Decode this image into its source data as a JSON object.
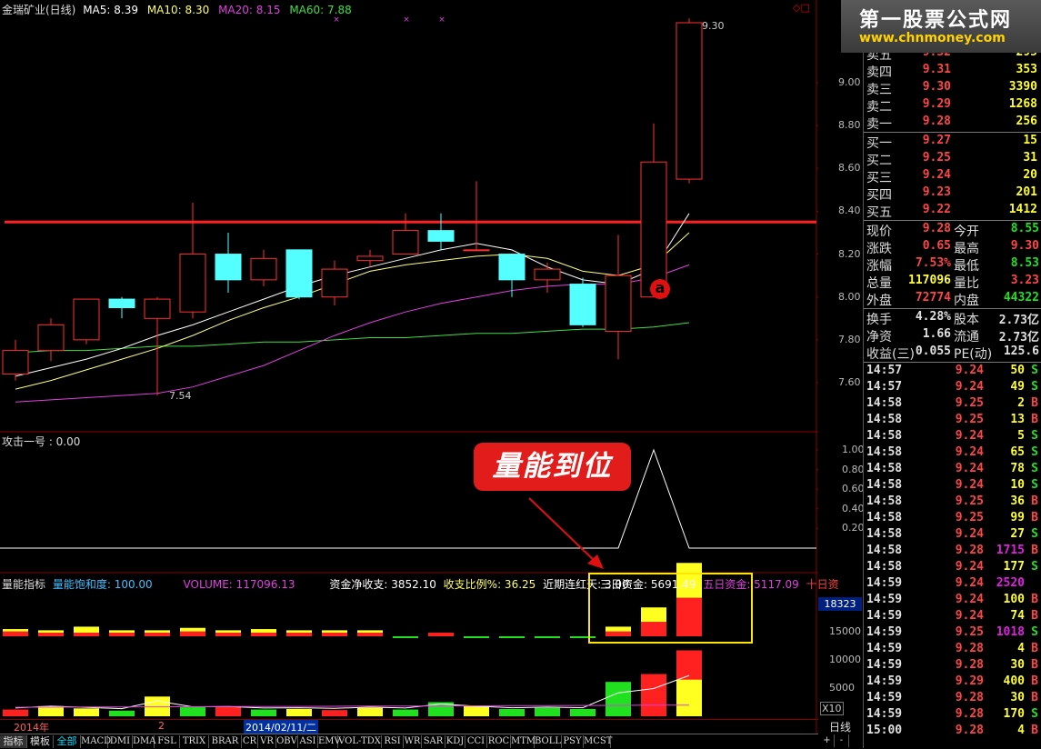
{
  "header": {
    "title": "金瑞矿业(日线)",
    "ma5": "MA5: 8.39",
    "ma10": "MA10: 8.30",
    "ma20": "MA20: 8.15",
    "ma60": "MA60: 7.88",
    "high_label": "9.30",
    "low_label": "7.54",
    "y_ticks": [
      "9.00",
      "8.80",
      "8.60",
      "8.40",
      "8.20",
      "8.00",
      "7.80",
      "7.60"
    ],
    "marker_a": "a"
  },
  "indicator1": {
    "title": "攻击一号 : 0.00",
    "y_ticks": [
      "1.00",
      "0.80",
      "0.60",
      "0.40",
      "0.20"
    ],
    "callout": "量能到位"
  },
  "indicator2": {
    "title": "量能指标",
    "saturation": "量能饱和度: 100.00",
    "volume": "VOLUME: 117096.13",
    "net_funds": "资金净收支: 3852.10",
    "ratio": "收支比例%: 36.25",
    "streak": "近期连红天: 3.00",
    "three_day": "三日资金: 5691.49",
    "five_day": "五日资金: 5117.09",
    "ten_day": "十日资",
    "current_value": "18323",
    "y_ticks": [
      "15000",
      "10000",
      "5000"
    ],
    "x10": "X10"
  },
  "timeline": {
    "year": "2014年",
    "mid": "2",
    "date": "2014/02/11/二",
    "period": "日线"
  },
  "tabs": [
    "指标",
    "模板",
    "全部",
    "MACD",
    "DMI",
    "DMA",
    "FSL",
    "TRIX",
    "BRAR",
    "CR",
    "VR",
    "OBV",
    "ASI",
    "EMV",
    "VOL-TDX",
    "RSI",
    "WR",
    "SAR",
    "KDJ",
    "CCI",
    "ROC",
    "MTM",
    "BOLL",
    "PSY",
    "MCST"
  ],
  "tab_controls": [
    "+",
    "-"
  ],
  "logo": {
    "title": "第一股票公式网",
    "url": "www.chnmoney.com"
  },
  "order_book": {
    "sell": [
      {
        "label": "卖五",
        "price": "9.32",
        "vol": "295"
      },
      {
        "label": "卖四",
        "price": "9.31",
        "vol": "353"
      },
      {
        "label": "卖三",
        "price": "9.30",
        "vol": "3390"
      },
      {
        "label": "卖二",
        "price": "9.29",
        "vol": "1268"
      },
      {
        "label": "卖一",
        "price": "9.28",
        "vol": "256"
      }
    ],
    "buy": [
      {
        "label": "买一",
        "price": "9.27",
        "vol": "15"
      },
      {
        "label": "买二",
        "price": "9.25",
        "vol": "31"
      },
      {
        "label": "买三",
        "price": "9.24",
        "vol": "20"
      },
      {
        "label": "买四",
        "price": "9.23",
        "vol": "201"
      },
      {
        "label": "买五",
        "price": "9.22",
        "vol": "1412"
      }
    ]
  },
  "quote": [
    {
      "l1": "现价",
      "v1": "9.28",
      "c1": "#ff4545",
      "l2": "今开",
      "v2": "8.55",
      "c2": "#20e020"
    },
    {
      "l1": "涨跌",
      "v1": "0.65",
      "c1": "#ff4545",
      "l2": "最高",
      "v2": "9.30",
      "c2": "#ff4545"
    },
    {
      "l1": "涨幅",
      "v1": "7.53%",
      "c1": "#ff4545",
      "l2": "最低",
      "v2": "8.53",
      "c2": "#20e020"
    },
    {
      "l1": "总量",
      "v1": "117096",
      "c1": "#ffff30",
      "l2": "量比",
      "v2": "3.23",
      "c2": "#ff4545"
    },
    {
      "l1": "外盘",
      "v1": "72774",
      "c1": "#ff4545",
      "l2": "内盘",
      "v2": "44322",
      "c2": "#20e020"
    }
  ],
  "quote2": [
    {
      "l1": "换手",
      "v1": "4.28%",
      "c1": "#e0e0e0",
      "l2": "股本",
      "v2": "2.73亿",
      "c2": "#e0e0e0"
    },
    {
      "l1": "净资",
      "v1": "1.66",
      "c1": "#e0e0e0",
      "l2": "流通",
      "v2": "2.73亿",
      "c2": "#e0e0e0"
    },
    {
      "l1": "收益(三)",
      "v1": "0.055",
      "c1": "#e0e0e0",
      "l2": "PE(动)",
      "v2": "125.6",
      "c2": "#e0e0e0"
    }
  ],
  "trades": [
    {
      "t": "14:57",
      "p": "9.24",
      "v": "50",
      "bs": "S"
    },
    {
      "t": "14:57",
      "p": "9.24",
      "v": "49",
      "bs": "S"
    },
    {
      "t": "14:58",
      "p": "9.25",
      "v": "2",
      "bs": "B"
    },
    {
      "t": "14:58",
      "p": "9.25",
      "v": "13",
      "bs": "B"
    },
    {
      "t": "14:58",
      "p": "9.24",
      "v": "5",
      "bs": "S"
    },
    {
      "t": "14:58",
      "p": "9.24",
      "v": "65",
      "bs": "S"
    },
    {
      "t": "14:58",
      "p": "9.24",
      "v": "78",
      "bs": "S"
    },
    {
      "t": "14:58",
      "p": "9.24",
      "v": "10",
      "bs": "S"
    },
    {
      "t": "14:58",
      "p": "9.25",
      "v": "36",
      "bs": "B"
    },
    {
      "t": "14:58",
      "p": "9.25",
      "v": "99",
      "bs": "B"
    },
    {
      "t": "14:58",
      "p": "9.24",
      "v": "27",
      "bs": "S"
    },
    {
      "t": "14:58",
      "p": "9.28",
      "v": "1715",
      "bs": "B",
      "big": true
    },
    {
      "t": "14:58",
      "p": "9.24",
      "v": "177",
      "bs": "S"
    },
    {
      "t": "14:59",
      "p": "9.24",
      "v": "2520",
      "bs": "",
      "big": true
    },
    {
      "t": "14:59",
      "p": "9.24",
      "v": "100",
      "bs": "B"
    },
    {
      "t": "14:59",
      "p": "9.24",
      "v": "74",
      "bs": "B"
    },
    {
      "t": "14:59",
      "p": "9.25",
      "v": "1018",
      "bs": "S",
      "big": true
    },
    {
      "t": "14:59",
      "p": "9.28",
      "v": "4",
      "bs": "B"
    },
    {
      "t": "14:59",
      "p": "9.28",
      "v": "30",
      "bs": "B"
    },
    {
      "t": "14:59",
      "p": "9.29",
      "v": "400",
      "bs": "B"
    },
    {
      "t": "14:59",
      "p": "9.28",
      "v": "30",
      "bs": "B"
    },
    {
      "t": "14:59",
      "p": "9.28",
      "v": "170",
      "bs": "S"
    },
    {
      "t": "15:00",
      "p": "9.28",
      "v": "4",
      "bs": "B"
    }
  ],
  "colors": {
    "up": "#ff3030",
    "down": "#54ffff",
    "ma5": "#ffffff",
    "ma10": "#ffff80",
    "ma20": "#e040e0",
    "ma60": "#40e040",
    "resistance": "#ff2020"
  },
  "chart_data": {
    "type": "candlestick",
    "ylim": [
      7.5,
      9.4
    ],
    "candles": [
      {
        "o": 7.64,
        "c": 7.75,
        "h": 7.8,
        "l": 7.61
      },
      {
        "o": 7.75,
        "c": 7.87,
        "h": 7.9,
        "l": 7.7
      },
      {
        "o": 7.8,
        "c": 7.99,
        "h": 7.99,
        "l": 7.78
      },
      {
        "o": 7.99,
        "c": 7.95,
        "h": 8.0,
        "l": 7.9
      },
      {
        "o": 7.9,
        "c": 7.99,
        "h": 8.0,
        "l": 7.54
      },
      {
        "o": 7.93,
        "c": 8.2,
        "h": 8.44,
        "l": 7.9
      },
      {
        "o": 8.2,
        "c": 8.08,
        "h": 8.3,
        "l": 8.02
      },
      {
        "o": 8.08,
        "c": 8.18,
        "h": 8.22,
        "l": 8.05
      },
      {
        "o": 8.22,
        "c": 8.0,
        "h": 8.22,
        "l": 7.99
      },
      {
        "o": 8.0,
        "c": 8.13,
        "h": 8.17,
        "l": 7.96
      },
      {
        "o": 8.17,
        "c": 8.19,
        "h": 8.22,
        "l": 8.14
      },
      {
        "o": 8.2,
        "c": 8.31,
        "h": 8.39,
        "l": 8.2
      },
      {
        "o": 8.31,
        "c": 8.26,
        "h": 8.39,
        "l": 8.22
      },
      {
        "o": 8.22,
        "c": 8.22,
        "h": 8.54,
        "l": 8.22
      },
      {
        "o": 8.2,
        "c": 8.08,
        "h": 8.2,
        "l": 8.0
      },
      {
        "o": 8.08,
        "c": 8.13,
        "h": 8.16,
        "l": 8.02
      },
      {
        "o": 8.06,
        "c": 7.87,
        "h": 8.09,
        "l": 7.86
      },
      {
        "o": 7.84,
        "c": 8.1,
        "h": 8.29,
        "l": 7.71
      },
      {
        "o": 8.0,
        "c": 8.63,
        "h": 8.81,
        "l": 8.0
      },
      {
        "o": 8.55,
        "c": 9.28,
        "h": 9.3,
        "l": 8.53
      }
    ],
    "resistance": 8.35,
    "ma5": [
      7.63,
      7.67,
      7.71,
      7.76,
      7.82,
      7.87,
      7.93,
      7.99,
      8.05,
      8.1,
      8.14,
      8.18,
      8.22,
      8.25,
      8.22,
      8.14,
      8.08,
      8.06,
      8.13,
      8.39
    ],
    "ma10": [
      7.57,
      7.61,
      7.66,
      7.71,
      7.76,
      7.82,
      7.89,
      7.95,
      8.0,
      8.06,
      8.12,
      8.15,
      8.17,
      8.19,
      8.2,
      8.18,
      8.12,
      8.1,
      8.15,
      8.3
    ],
    "ma20": [
      7.51,
      7.52,
      7.53,
      7.54,
      7.55,
      7.58,
      7.63,
      7.68,
      7.75,
      7.82,
      7.88,
      7.93,
      7.97,
      8.0,
      8.03,
      8.05,
      8.06,
      8.06,
      8.09,
      8.15
    ],
    "ma60": [
      7.74,
      7.75,
      7.75,
      7.76,
      7.77,
      7.77,
      7.78,
      7.79,
      7.79,
      7.8,
      7.81,
      7.81,
      7.82,
      7.83,
      7.83,
      7.84,
      7.85,
      7.85,
      7.86,
      7.88
    ],
    "attack_signal": [
      0,
      0,
      0,
      0,
      0,
      0,
      0,
      0,
      0,
      0,
      0,
      0,
      0,
      0,
      0,
      0,
      0,
      0,
      1,
      0
    ],
    "volume": [
      {
        "v": 1200,
        "up": true
      },
      {
        "v": 1800,
        "up": true
      },
      {
        "v": 1400,
        "up": true
      },
      {
        "v": 1000,
        "up": false
      },
      {
        "v": 3500,
        "up": true
      },
      {
        "v": 1600,
        "up": false
      },
      {
        "v": 1700,
        "up": true
      },
      {
        "v": 1200,
        "up": false
      },
      {
        "v": 1300,
        "up": true
      },
      {
        "v": 1100,
        "up": true
      },
      {
        "v": 1500,
        "up": true
      },
      {
        "v": 1200,
        "up": false
      },
      {
        "v": 2500,
        "up": false
      },
      {
        "v": 1800,
        "up": true
      },
      {
        "v": 1300,
        "up": false
      },
      {
        "v": 1500,
        "up": false
      },
      {
        "v": 1300,
        "up": false
      },
      {
        "v": 6100,
        "up": false
      },
      {
        "v": 7500,
        "up": true
      },
      {
        "v": 11700,
        "up": true
      }
    ],
    "capital_flow": [
      {
        "r": 400,
        "y": 200
      },
      {
        "r": 300,
        "y": 200
      },
      {
        "r": 300,
        "y": 500
      },
      {
        "r": 300,
        "y": 200
      },
      {
        "r": 300,
        "y": 200
      },
      {
        "r": 400,
        "y": 300
      },
      {
        "r": 300,
        "y": 200
      },
      {
        "r": 300,
        "y": 300
      },
      {
        "r": 300,
        "y": 200
      },
      {
        "r": 300,
        "y": 200
      },
      {
        "r": 300,
        "y": 200
      },
      {
        "r": -200,
        "y": 0
      },
      {
        "r": 300,
        "y": 0
      },
      {
        "r": -200,
        "y": 0
      },
      {
        "r": -100,
        "y": 0
      },
      {
        "r": -200,
        "y": 0
      },
      {
        "r": -300,
        "y": 0
      },
      {
        "r": 400,
        "y": 400
      },
      {
        "r": 1200,
        "y": 1200
      },
      {
        "r": 3200,
        "y": 2900
      }
    ]
  }
}
